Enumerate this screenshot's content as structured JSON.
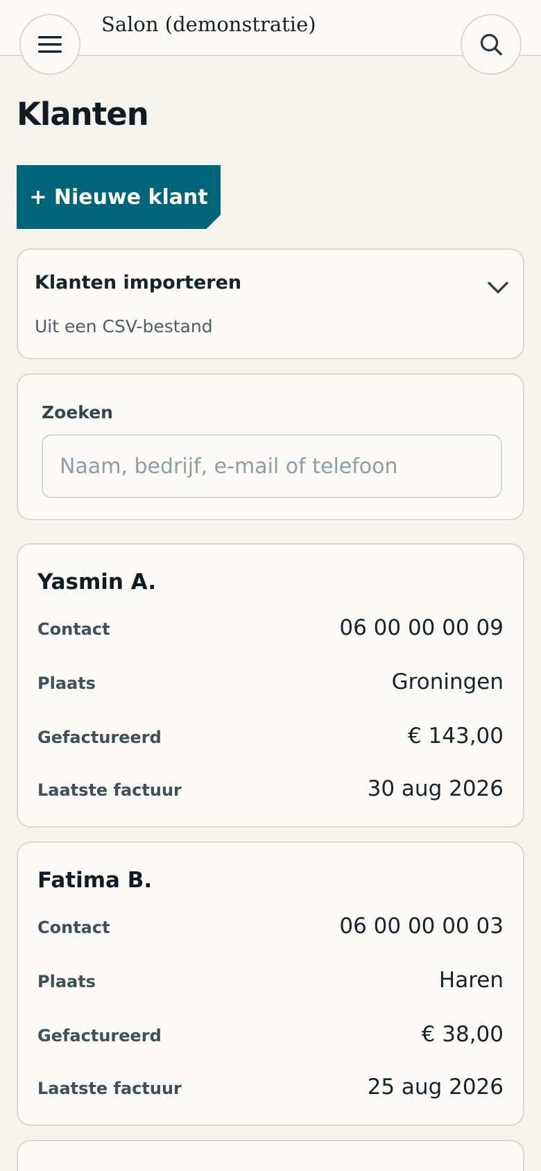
{
  "header": {
    "brand": "Salon (demonstratie)",
    "menu_icon": "hamburger-menu-icon",
    "search_icon": "search-icon"
  },
  "page": {
    "title": "Klanten",
    "new_client_button": "+ Nieuwe klant"
  },
  "import": {
    "title": "Klanten importeren",
    "subtitle": "Uit een CSV-bestand",
    "icon": "chevron-down-icon"
  },
  "search": {
    "label": "Zoeken",
    "placeholder": "Naam, bedrijf, e-mail of telefoon",
    "value": ""
  },
  "labels": {
    "contact": "Contact",
    "place": "Plaats",
    "invoiced": "Gefactureerd",
    "last_invoice": "Laatste factuur"
  },
  "clients": [
    {
      "name": "Yasmin A.",
      "contact": "06 00 00 00 09",
      "place": "Groningen",
      "invoiced": "€ 143,00",
      "last_invoice": "30 aug 2026"
    },
    {
      "name": "Fatima B.",
      "contact": "06 00 00 00 03",
      "place": "Haren",
      "invoiced": "€ 38,00",
      "last_invoice": "25 aug 2026"
    }
  ],
  "colors": {
    "accent": "#006579",
    "background": "#f6f4ef",
    "card": "#fcfaf6",
    "border": "#dcd8cc"
  }
}
